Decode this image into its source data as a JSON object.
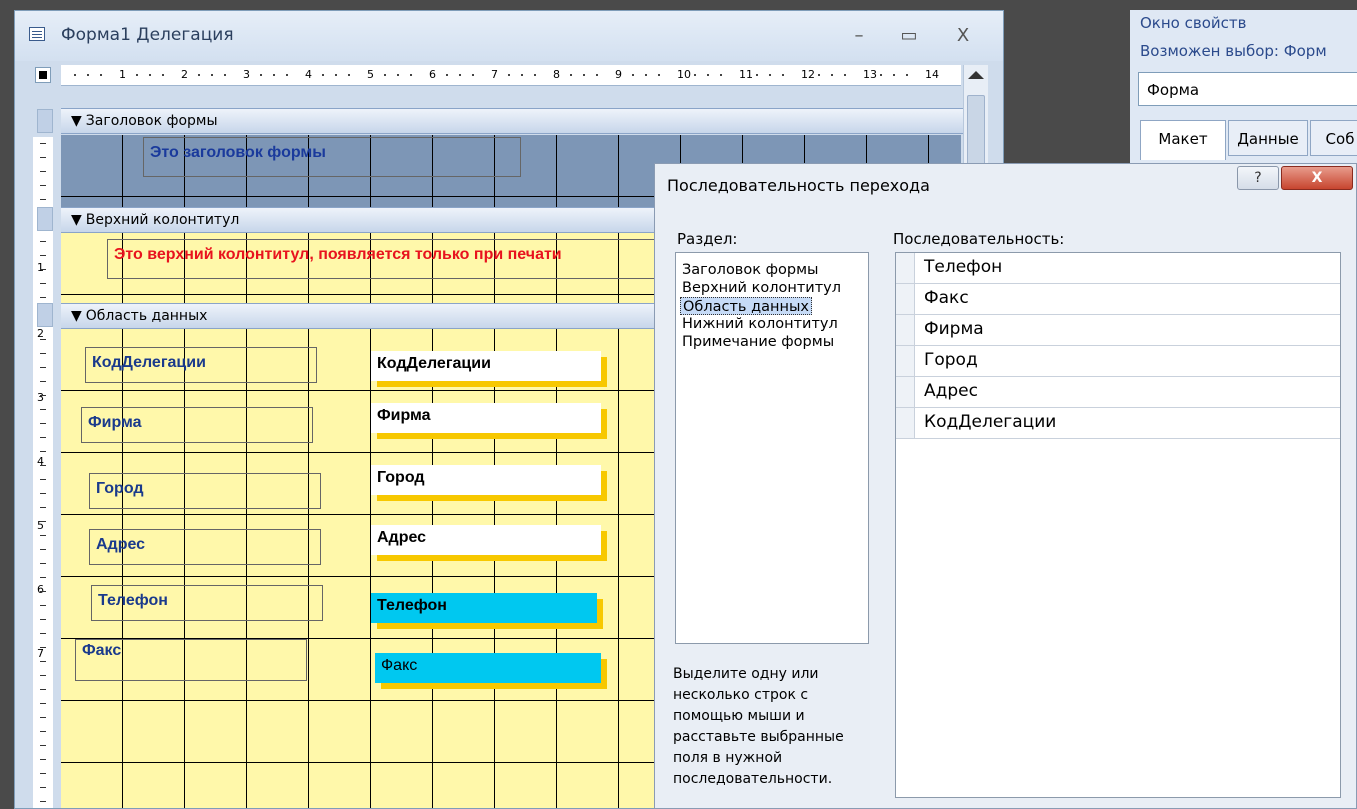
{
  "form_window": {
    "title": "Форма1 Делегация",
    "minimize": "–",
    "restore": "▭",
    "close": "X",
    "ruler_numbers": [
      "1",
      "2",
      "3",
      "4",
      "5",
      "6",
      "7",
      "8",
      "9",
      "10",
      "11",
      "12",
      "13",
      "14"
    ],
    "vruler_numbers": [
      "1",
      "2",
      "3",
      "4",
      "5",
      "6",
      "7"
    ],
    "sections": {
      "form_header": {
        "title": "Заголовок формы",
        "caption": "Это заголовок формы"
      },
      "page_header": {
        "title": "Верхний колонтитул",
        "caption": "Это верхний колонтитул, появляется только при печати"
      },
      "detail": {
        "title": "Область данных",
        "labels": [
          "КодДелегации",
          "Фирма",
          "Город",
          "Адрес",
          "Телефон",
          "Факс"
        ],
        "fields": [
          "КодДелегации",
          "Фирма",
          "Город",
          "Адрес",
          "Телефон",
          "Факс"
        ]
      }
    }
  },
  "property_sheet": {
    "title": "Окно свойств",
    "selection_type": "Возможен выбор:  Форм",
    "selected_object": "Форма",
    "tabs": [
      "Макет",
      "Данные",
      "Соб"
    ]
  },
  "tab_order_dialog": {
    "title": "Последовательность перехода",
    "help_button": "?",
    "close_button": "X",
    "section_label": "Раздел:",
    "order_label": "Последовательность:",
    "sections": [
      "Заголовок формы",
      "Верхний колонтитул",
      "Область данных",
      "Нижний колонтитул",
      "Примечание формы"
    ],
    "selected_section": "Область данных",
    "order": [
      "Телефон",
      "Факс",
      "Фирма",
      "Город",
      "Адрес",
      "КодДелегации"
    ],
    "hint": "Выделите одну или несколько строк с помощью мыши и расставьте выбранные поля в нужной последовательности."
  }
}
